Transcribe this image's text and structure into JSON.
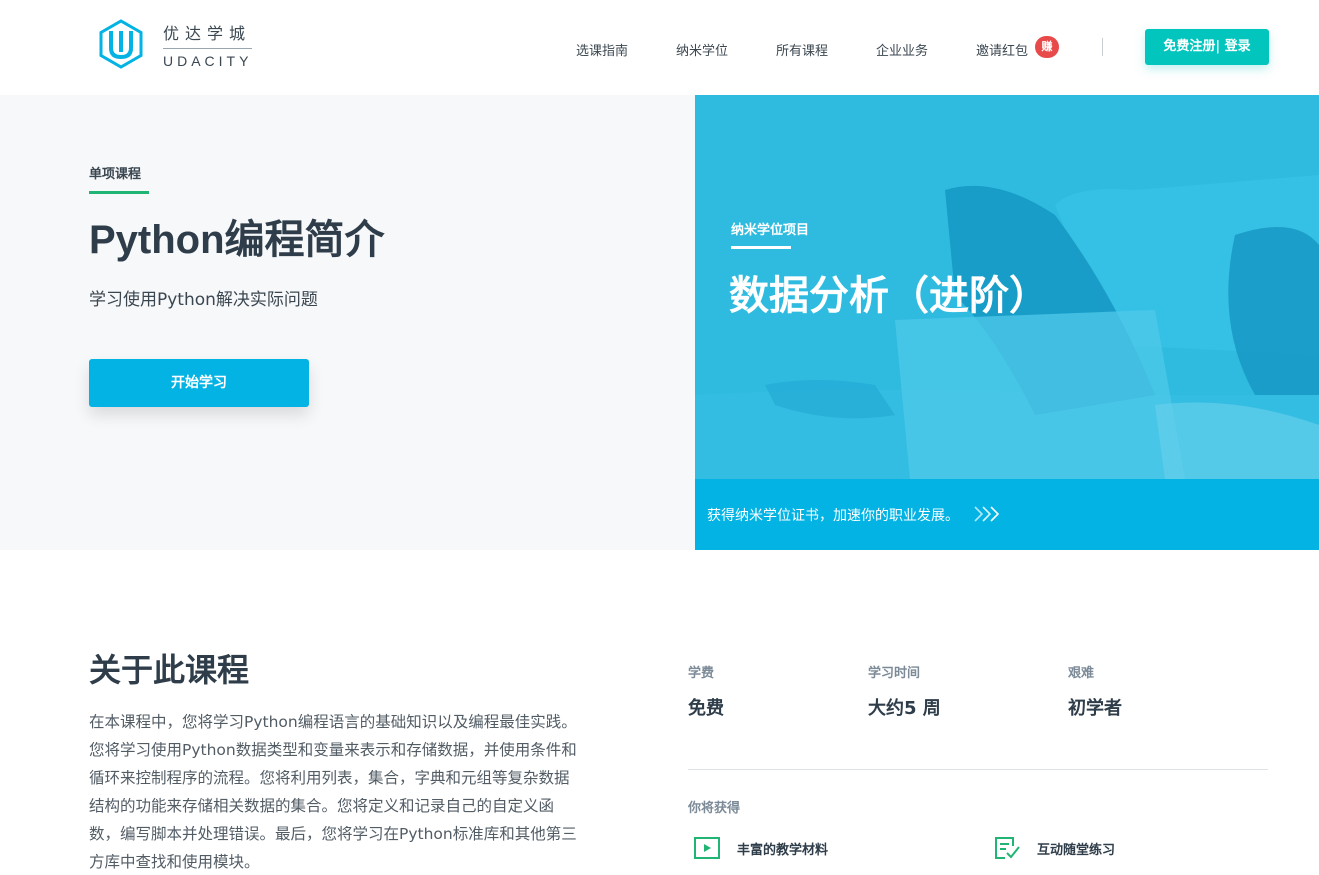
{
  "header": {
    "logo": {
      "cn": "优达学城",
      "en": "UDACITY"
    },
    "nav": [
      {
        "label": "选课指南"
      },
      {
        "label": "纳米学位"
      },
      {
        "label": "所有课程"
      },
      {
        "label": "企业业务"
      },
      {
        "label": "邀请红包"
      }
    ],
    "badge": "赚",
    "signup_label": "免费注册| 登录"
  },
  "hero": {
    "kicker": "单项课程",
    "title": "Python编程简介",
    "subtitle": "学习使用Python解决实际问题",
    "cta_label": "开始学习"
  },
  "promo": {
    "kicker": "纳米学位项目",
    "title": "数据分析（进阶）",
    "footer_text": "获得纳米学位证书，加速你的职业发展。"
  },
  "about": {
    "title": "关于此课程",
    "body": "在本课程中，您将学习Python编程语言的基础知识以及编程最佳实践。您将学习使用Python数据类型和变量来表示和存储数据，并使用条件和循环来控制程序的流程。您将利用列表，集合，字典和元组等复杂数据结构的功能来存储相关数据的集合。您将定义和记录自己的自定义函数，编写脚本并处理错误。最后，您将学习在Python标准库和其他第三方库中查找和使用模块。"
  },
  "stats": [
    {
      "label": "学费",
      "value": "免费"
    },
    {
      "label": "学习时间",
      "value": "大约5 周"
    },
    {
      "label": "艰难",
      "value": "初学者"
    }
  ],
  "gains": {
    "label": "你将获得",
    "features": [
      {
        "label": "丰富的教学材料",
        "icon": "video-play-icon"
      },
      {
        "label": "互动随堂练习",
        "icon": "quiz-check-icon"
      }
    ]
  },
  "colors": {
    "brand_blue": "#02b3e4",
    "signup_teal": "#02c5be",
    "badge_red": "#e84a4a",
    "feature_green": "#21b573"
  }
}
